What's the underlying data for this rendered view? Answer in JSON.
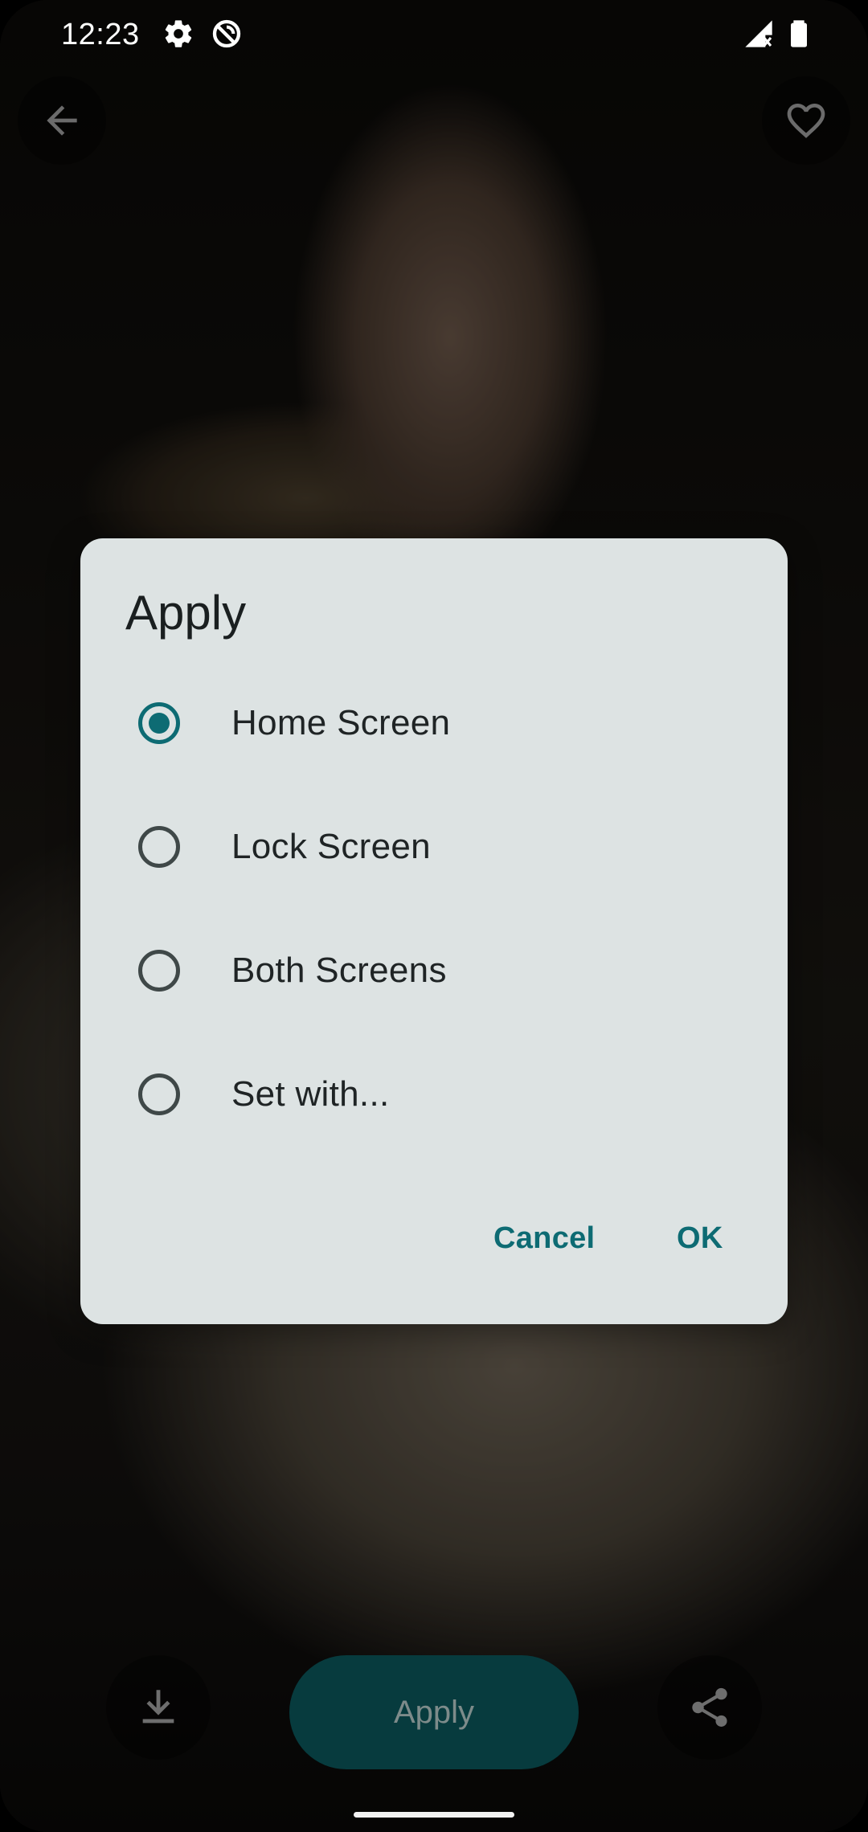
{
  "status_bar": {
    "time": "12:23",
    "icons": [
      "gear-icon",
      "data-saver-icon",
      "signal-icon",
      "battery-icon"
    ]
  },
  "top_bar": {
    "back_icon": "arrow-back-icon",
    "favorite_icon": "heart-outline-icon"
  },
  "dialog": {
    "title": "Apply",
    "options": [
      {
        "label": "Home Screen",
        "selected": true
      },
      {
        "label": "Lock Screen",
        "selected": false
      },
      {
        "label": "Both Screens",
        "selected": false
      },
      {
        "label": "Set with...",
        "selected": false
      }
    ],
    "cancel_label": "Cancel",
    "ok_label": "OK"
  },
  "bottom_bar": {
    "download_icon": "download-icon",
    "apply_label": "Apply",
    "share_icon": "share-icon"
  },
  "colors": {
    "accent": "#0d6b73",
    "dialog_background": "#dde3e3",
    "apply_button": "#073b3e"
  }
}
